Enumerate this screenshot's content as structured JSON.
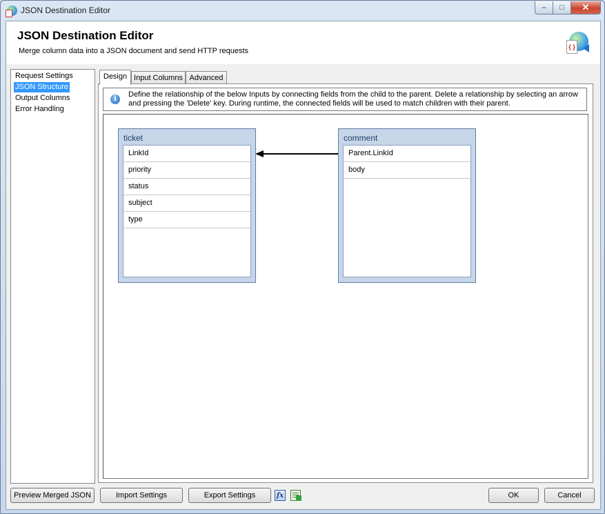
{
  "window": {
    "title": "JSON Destination Editor",
    "controls": {
      "minimize": "–",
      "maximize": "□",
      "close": "✕"
    }
  },
  "header": {
    "title": "JSON Destination Editor",
    "subtitle": "Merge column data into a JSON document and send HTTP requests",
    "icon": "json-globe-icon",
    "icon_glyph": "{ }"
  },
  "nav": {
    "items": [
      {
        "label": "Request Settings",
        "selected": false
      },
      {
        "label": "JSON Structure",
        "selected": true
      },
      {
        "label": "Output Columns",
        "selected": false
      },
      {
        "label": "Error Handling",
        "selected": false
      }
    ]
  },
  "tabs": [
    {
      "label": "Design",
      "active": true
    },
    {
      "label": "Input Columns",
      "active": false
    },
    {
      "label": "Advanced",
      "active": false
    }
  ],
  "info": {
    "icon": "info-icon",
    "icon_glyph": "i",
    "text": "Define the relationship of the below Inputs by connecting fields from the child to the parent. Delete a relationship by selecting an arrow and pressing the 'Delete' key. During runtime, the connected fields will be used to match children with their parent."
  },
  "design": {
    "tables": [
      {
        "name": "ticket",
        "fields": [
          "LinkId",
          "priority",
          "status",
          "subject",
          "type"
        ]
      },
      {
        "name": "comment",
        "fields": [
          "Parent.LinkId",
          "body"
        ]
      }
    ],
    "relationship": {
      "child": "comment",
      "child_field": "Parent.LinkId",
      "parent": "ticket",
      "parent_field": "LinkId"
    },
    "colors": {
      "table_header": "#c6d5e8",
      "table_border": "#5d7ea6",
      "selection": "#3399ff"
    }
  },
  "footer": {
    "preview_label": "Preview Merged JSON",
    "import_label": "Import Settings",
    "export_label": "Export Settings",
    "fx_icon": "expression-icon",
    "fx_glyph": "fx",
    "csv_icon": "variables-icon",
    "ok_label": "OK",
    "cancel_label": "Cancel"
  }
}
